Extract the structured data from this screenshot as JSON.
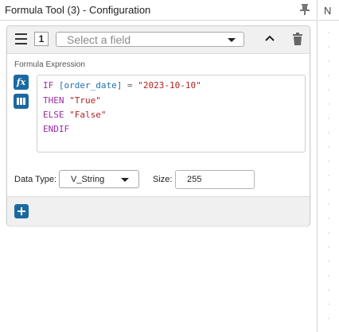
{
  "window": {
    "title": "Formula Tool (3) - Configuration"
  },
  "formula": {
    "index": "1",
    "field_placeholder": "Select a field",
    "expression_label": "Formula Expression",
    "fx_label": "fx",
    "code": {
      "line1": {
        "kw": "IF",
        "field": "[order_date]",
        "op": "=",
        "str": "\"2023-10-10\""
      },
      "line2": {
        "kw": "THEN",
        "str": "\"True\""
      },
      "line3": {
        "kw": "ELSE",
        "str": "\"False\""
      },
      "line4": {
        "kw": "ENDIF"
      }
    },
    "data_type_label": "Data Type:",
    "data_type_value": "V_String",
    "size_label": "Size:",
    "size_value": "255"
  },
  "side_tab": {
    "label": "N"
  },
  "colors": {
    "accent": "#1a6aa0",
    "keyword": "#9c2aa4",
    "field": "#1f6fb3",
    "string": "#b22222"
  }
}
